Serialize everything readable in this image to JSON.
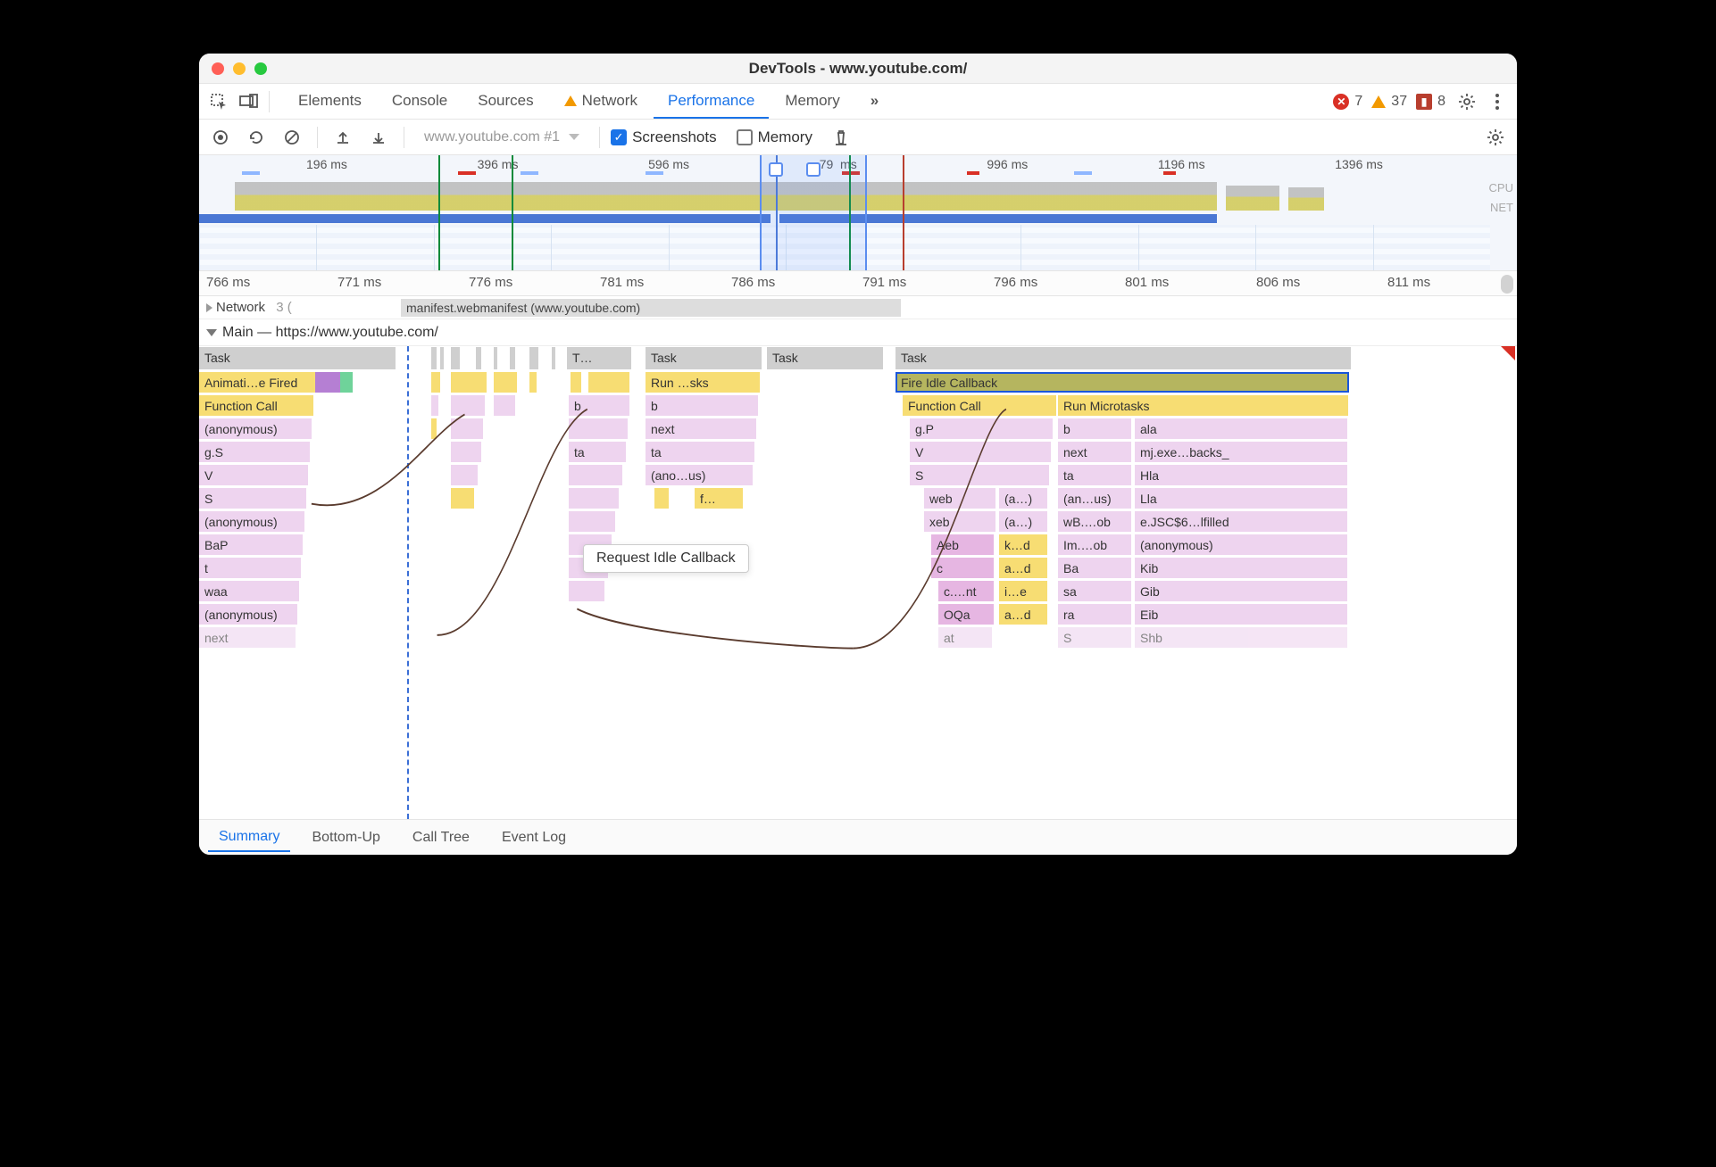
{
  "title": "DevTools - www.youtube.com/",
  "tabs": [
    "Elements",
    "Console",
    "Sources",
    "Network",
    "Performance",
    "Memory"
  ],
  "active_tab": "Performance",
  "warn_tab": "Network",
  "badges": {
    "errors": "7",
    "warnings": "37",
    "blocked": "8"
  },
  "toolbar": {
    "recording_label": "www.youtube.com #1",
    "screenshots_label": "Screenshots",
    "screenshots_checked": true,
    "memory_label": "Memory",
    "memory_checked": false
  },
  "overview": {
    "ticks": [
      "196 ms",
      "396 ms",
      "596 ms",
      "79",
      "996 ms",
      "1196 ms",
      "1396 ms"
    ],
    "ms_mid": "ms",
    "labels": [
      "CPU",
      "NET"
    ]
  },
  "detail_ticks": [
    "766 ms",
    "771 ms",
    "776 ms",
    "781 ms",
    "786 ms",
    "791 ms",
    "796 ms",
    "801 ms",
    "806 ms",
    "811 ms"
  ],
  "network": {
    "header": "Network",
    "header_count": "3 (",
    "req": "manifest.webmanifest (www.youtube.com)"
  },
  "main_header": "Main — https://www.youtube.com/",
  "tooltip_text": "Request Idle Callback",
  "bottom_tabs": [
    "Summary",
    "Bottom-Up",
    "Call Tree",
    "Event Log"
  ],
  "active_bottom_tab": "Summary",
  "flame": {
    "task_row_labels": {
      "a": "Task",
      "b": "T…",
      "c": "Task",
      "d": "Task",
      "e": "Task"
    },
    "l1": {
      "a": "Animati…e Fired",
      "c": "Run …sks",
      "e": "Fire Idle Callback"
    },
    "l2": {
      "a": "Function Call",
      "bb": "b",
      "cc": "b",
      "e1": "Function Call",
      "e2": "Run Microtasks"
    },
    "l3": {
      "a": "(anonymous)",
      "cc": "next",
      "e1": "g.P",
      "e2": "b",
      "e3": "ala"
    },
    "l4": {
      "a": "g.S",
      "bb": "ta",
      "cc": "ta",
      "e1": "V",
      "e2": "next",
      "e3": "mj.exe…backs_"
    },
    "l5": {
      "a": "V",
      "cc": "(ano…us)",
      "e1": "S",
      "e2": "ta",
      "e3": "Hla"
    },
    "l6": {
      "a": "S",
      "cc": "f…",
      "e1": "web",
      "e1b": "(a…)",
      "e2": "(an…us)",
      "e3": "Lla"
    },
    "l7": {
      "a": "(anonymous)",
      "e1": "xeb",
      "e1b": "(a…)",
      "e2": "wB.…ob",
      "e3": "e.JSC$6…lfilled"
    },
    "l8": {
      "a": "BaP",
      "e1": "Aeb",
      "e1b": "k…d",
      "e2": "Im.…ob",
      "e3": "(anonymous)"
    },
    "l9": {
      "a": "t",
      "e1": "c",
      "e1b": "a…d",
      "e2": "Ba",
      "e3": "Kib"
    },
    "l10": {
      "a": "waa",
      "e1": "c.…nt",
      "e1b": "i…e",
      "e2": "sa",
      "e3": "Gib"
    },
    "l11": {
      "a": "(anonymous)",
      "e1": "OQa",
      "e1b": "a…d",
      "e2": "ra",
      "e3": "Eib"
    },
    "l12": {
      "a": "next",
      "e1": "at",
      "e2": "S",
      "e3": "Shb"
    }
  }
}
